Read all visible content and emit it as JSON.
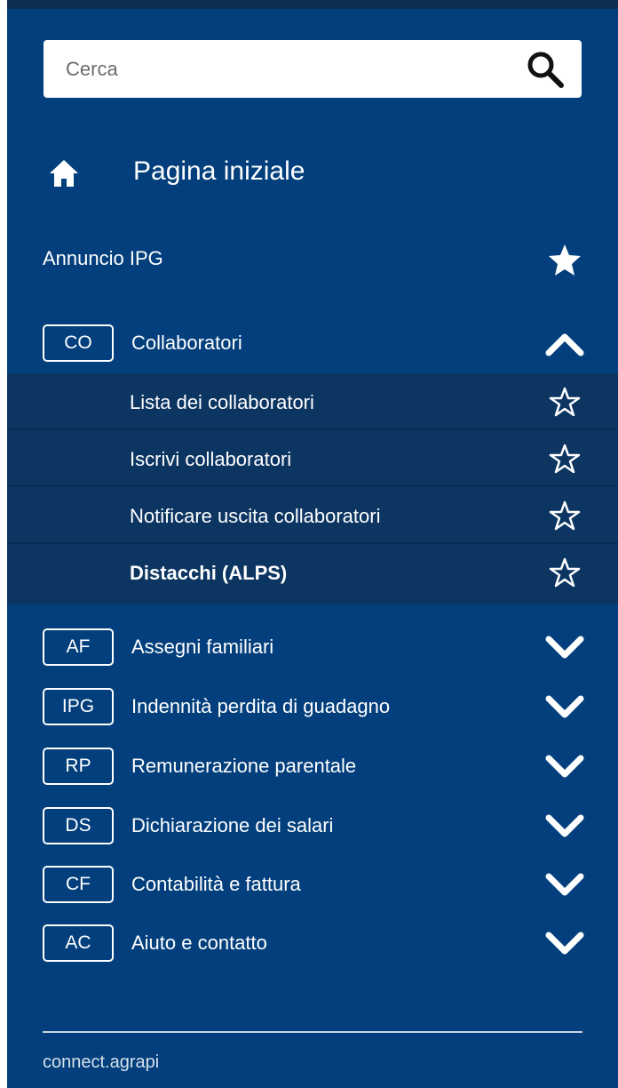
{
  "search": {
    "placeholder": "Cerca",
    "value": "",
    "icon": "search-icon"
  },
  "home": {
    "label": "Pagina iniziale",
    "icon": "home-icon"
  },
  "favorites": [
    {
      "label": "Annuncio IPG",
      "icon": "star-filled-icon"
    }
  ],
  "nav": {
    "expanded_group": {
      "badge": "CO",
      "label": "Collaboratori",
      "icon": "chevron-up-icon",
      "items": [
        {
          "label": "Lista dei collaboratori",
          "icon": "star-outline-icon"
        },
        {
          "label": "Iscrivi collaboratori",
          "icon": "star-outline-icon"
        },
        {
          "label": "Notificare uscita collaboratori",
          "icon": "star-outline-icon"
        },
        {
          "label": "Distacchi (ALPS)",
          "icon": "star-outline-icon"
        }
      ]
    },
    "collapsed_groups": [
      {
        "badge": "AF",
        "label": "Assegni familiari",
        "icon": "chevron-down-icon"
      },
      {
        "badge": "IPG",
        "label": "Indennità perdita di guadagno",
        "icon": "chevron-down-icon"
      },
      {
        "badge": "RP",
        "label": "Remunerazione parentale",
        "icon": "chevron-down-icon"
      },
      {
        "badge": "DS",
        "label": "Dichiarazione dei salari",
        "icon": "chevron-down-icon"
      },
      {
        "badge": "CF",
        "label": "Contabilità e fattura",
        "icon": "chevron-down-icon"
      },
      {
        "badge": "AC",
        "label": "Aiuto e contatto",
        "icon": "chevron-down-icon"
      }
    ]
  },
  "footer": {
    "text": "connect.agrapi"
  },
  "colors": {
    "panel_bg": "#023f7c",
    "submenu_bg": "#0c3562",
    "text": "#ffffff"
  }
}
